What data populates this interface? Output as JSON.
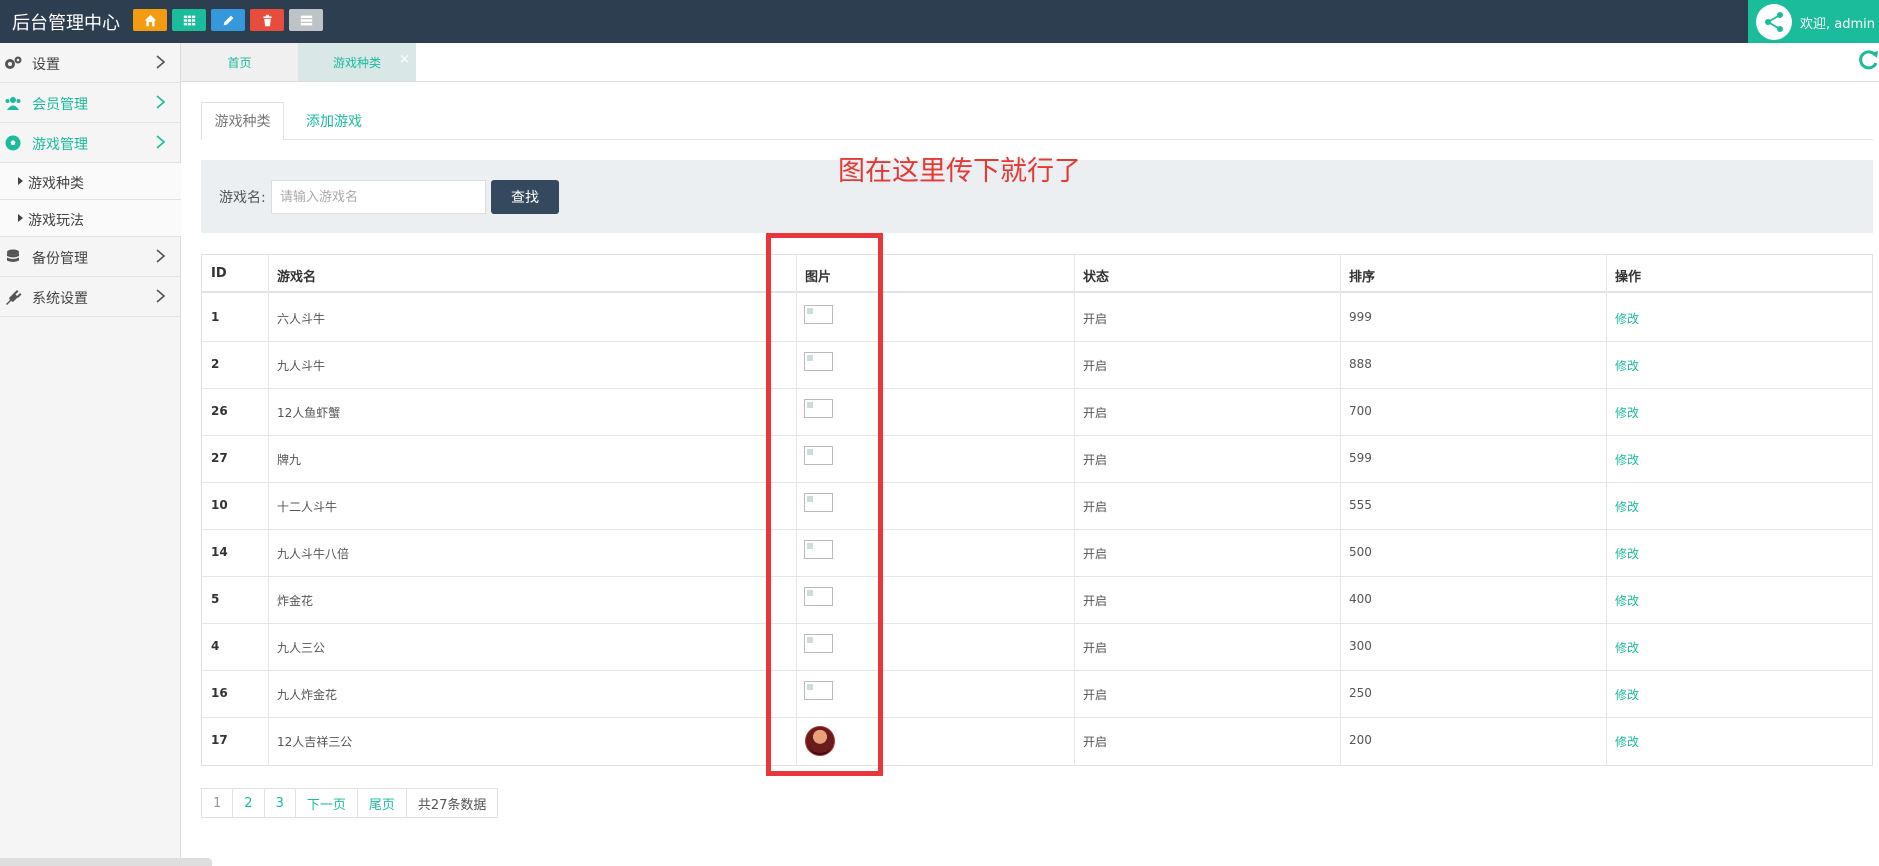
{
  "header": {
    "brand": "后台管理中心",
    "quick_buttons": [
      {
        "icon": "home-icon",
        "color": "#f39c12"
      },
      {
        "icon": "grid-icon",
        "color": "#1abc9c"
      },
      {
        "icon": "pencil-icon",
        "color": "#3498db"
      },
      {
        "icon": "trash-icon",
        "color": "#e74c3c"
      },
      {
        "icon": "list-icon",
        "color": "#bdc3c7"
      }
    ],
    "welcome": "欢迎, admin ▾"
  },
  "sidebar": {
    "items": [
      {
        "label": "设置",
        "icon": "gears-icon"
      },
      {
        "label": "会员管理",
        "icon": "users-icon"
      },
      {
        "label": "游戏管理",
        "icon": "soccer-ball-icon"
      },
      {
        "label": "备份管理",
        "icon": "database-icon"
      },
      {
        "label": "系统设置",
        "icon": "plug-icon"
      }
    ],
    "subitems": [
      {
        "label": "游戏种类"
      },
      {
        "label": "游戏玩法"
      }
    ]
  },
  "tabs": {
    "home": "首页",
    "current": "游戏种类",
    "close": "×"
  },
  "inner_tabs": {
    "active": "游戏种类",
    "other": "添加游戏"
  },
  "search": {
    "label": "游戏名:",
    "placeholder": "请输入游戏名",
    "button": "查找"
  },
  "annotation": "图在这里传下就行了",
  "table": {
    "headers": [
      "ID",
      "游戏名",
      "图片",
      "状态",
      "排序",
      "操作"
    ],
    "rows": [
      {
        "id": "1",
        "name": "六人斗牛",
        "status": "开启",
        "sort": "999",
        "op": "修改"
      },
      {
        "id": "2",
        "name": "九人斗牛",
        "status": "开启",
        "sort": "888",
        "op": "修改"
      },
      {
        "id": "26",
        "name": "12人鱼虾蟹",
        "status": "开启",
        "sort": "700",
        "op": "修改"
      },
      {
        "id": "27",
        "name": "牌九",
        "status": "开启",
        "sort": "599",
        "op": "修改"
      },
      {
        "id": "10",
        "name": "十二人斗牛",
        "status": "开启",
        "sort": "555",
        "op": "修改"
      },
      {
        "id": "14",
        "name": "九人斗牛八倍",
        "status": "开启",
        "sort": "500",
        "op": "修改"
      },
      {
        "id": "5",
        "name": "炸金花",
        "status": "开启",
        "sort": "400",
        "op": "修改"
      },
      {
        "id": "4",
        "name": "九人三公",
        "status": "开启",
        "sort": "300",
        "op": "修改"
      },
      {
        "id": "16",
        "name": "九人炸金花",
        "status": "开启",
        "sort": "250",
        "op": "修改"
      },
      {
        "id": "17",
        "name": "12人吉祥三公",
        "status": "开启",
        "sort": "200",
        "op": "修改"
      }
    ]
  },
  "pagination": {
    "pages": [
      "1",
      "2",
      "3"
    ],
    "next": "下一页",
    "last": "尾页",
    "total": "共27条数据"
  },
  "colors": {
    "header_bg": "#2c3e50",
    "accent": "#1abc9c",
    "annotation": "#e53935",
    "search_button": "#34495e"
  }
}
